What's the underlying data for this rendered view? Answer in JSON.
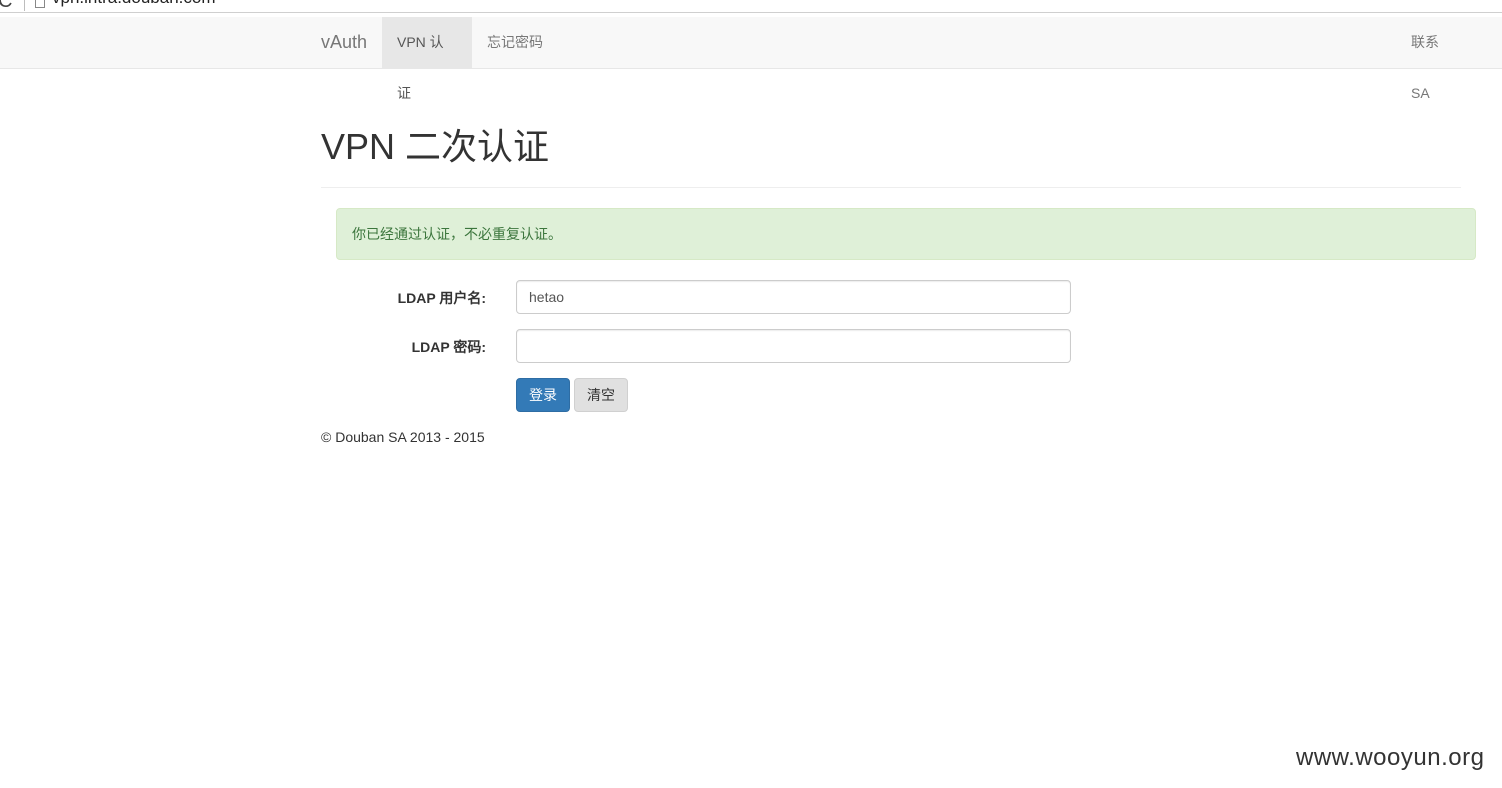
{
  "browser": {
    "url": "vpn.intra.douban.com"
  },
  "navbar": {
    "brand": "vAuth",
    "items": [
      {
        "label": "VPN 认证",
        "active": true
      },
      {
        "label": "忘记密码",
        "active": false
      }
    ],
    "contact": "联系 SA"
  },
  "page": {
    "title": "VPN 二次认证"
  },
  "alert": {
    "message": "你已经通过认证，不必重复认证。",
    "color": "#dff0d8"
  },
  "form": {
    "username_label": "LDAP 用户名:",
    "username_value": "hetao",
    "password_label": "LDAP 密码:",
    "password_value": "",
    "submit_label": "登录",
    "clear_label": "清空",
    "primary_color": "#337ab7"
  },
  "footer": {
    "copyright": "© Douban SA 2013 - 2015"
  },
  "watermark": {
    "text": "www.wooyun.org"
  }
}
